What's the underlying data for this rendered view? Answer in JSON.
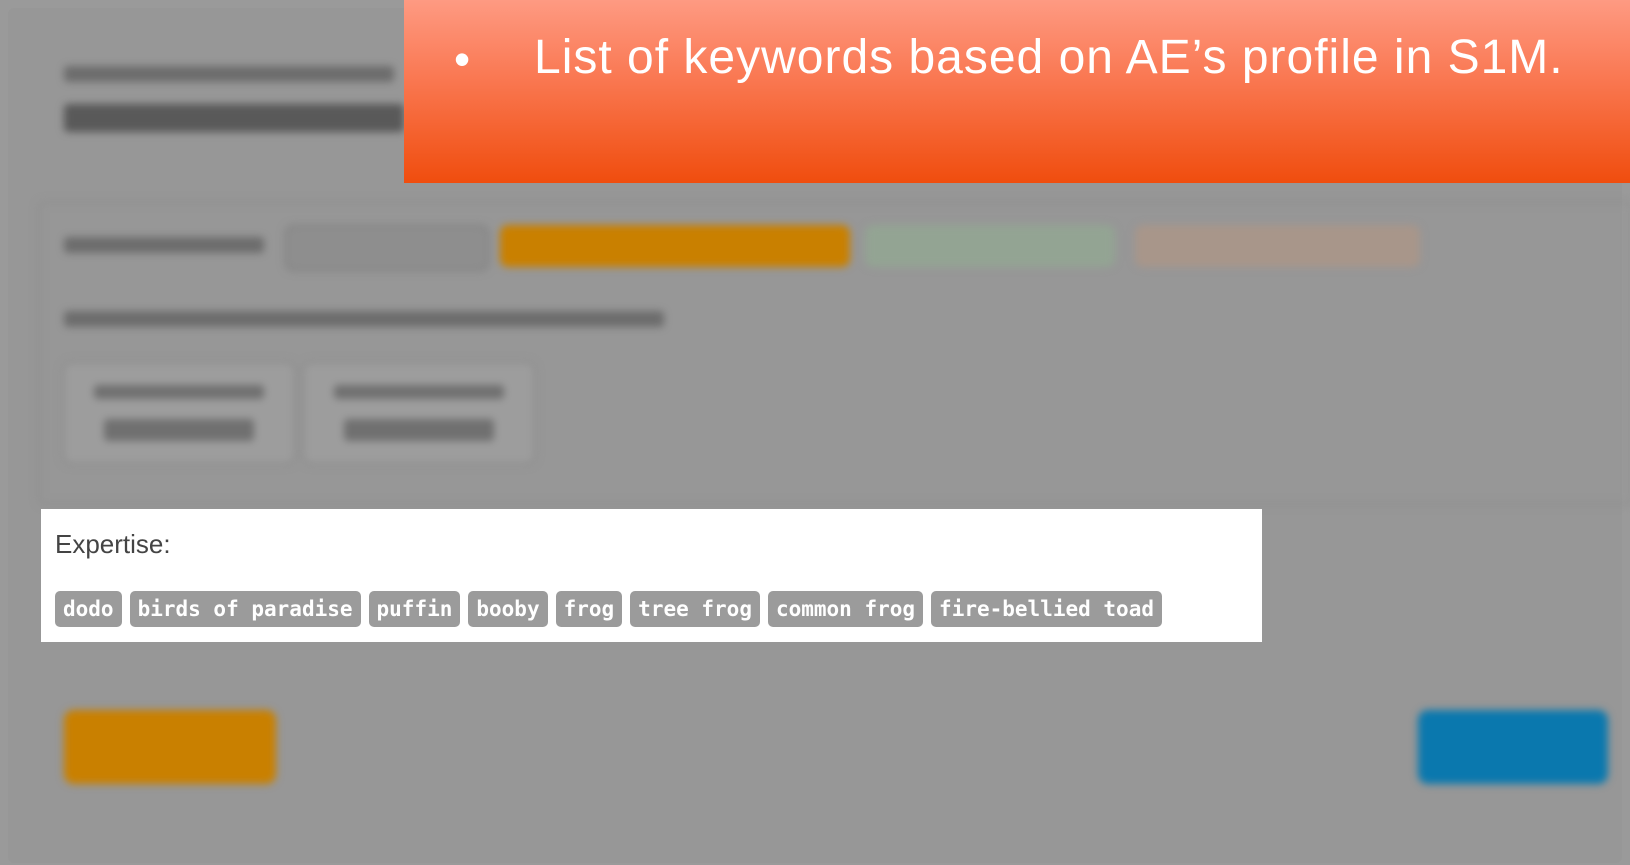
{
  "callout": {
    "bullet": "•",
    "text": "List of keywords based on AE’s profile in S1M."
  },
  "expertise": {
    "label": "Expertise:",
    "tags": [
      "dodo",
      "birds of paradise",
      "puffin",
      "booby",
      "frog",
      "tree frog",
      "common frog",
      "fire-bellied toad"
    ]
  },
  "colors": {
    "background": "#9a9a9a",
    "callout_top": "#fe9a82",
    "callout_bottom": "#f04d0e",
    "tag_bg": "#9b9b9b",
    "submit_button": "#c98000",
    "help_button": "#0a78ae"
  }
}
